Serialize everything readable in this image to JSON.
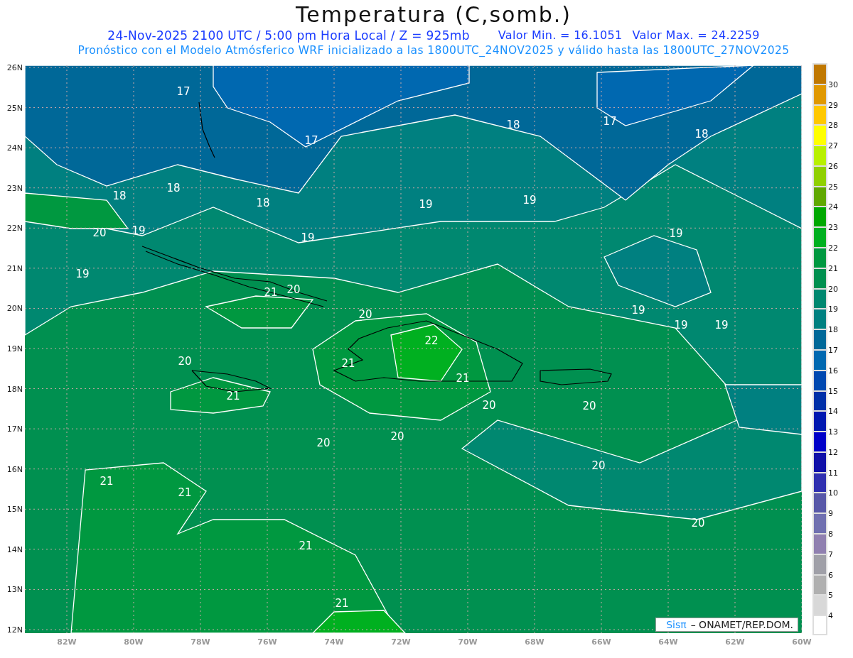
{
  "title": "Temperatura (C,somb.)",
  "subtitle": "24-Nov-2025  2100 UTC / 5:00 pm Hora Local / Z = 925mb",
  "value_min": "Valor Min. = 16.1051",
  "value_max": "Valor Max. = 24.2259",
  "forecast_note": "Pronóstico con el Modelo Atmósferico WRF inicializado a las 1800UTC_24NOV2025 y válido hasta las  1800UTC_27NOV2025",
  "map": {
    "lat_labels": [
      "26N",
      "25N",
      "24N",
      "23N",
      "22N",
      "21N",
      "20N",
      "19N",
      "18N",
      "17N",
      "16N",
      "15N",
      "14N",
      "13N",
      "12N"
    ],
    "lon_labels": [
      "82W",
      "80W",
      "78W",
      "76W",
      "74W",
      "72W",
      "70W",
      "68W",
      "66W",
      "64W",
      "62W",
      "60W"
    ],
    "contour_labels": [
      "17",
      "18",
      "17",
      "17",
      "18",
      "18",
      "18",
      "18",
      "19",
      "19",
      "20",
      "19",
      "19",
      "19",
      "19",
      "21",
      "20",
      "20",
      "19",
      "19",
      "19",
      "22",
      "20",
      "21",
      "21",
      "21",
      "20",
      "20",
      "20",
      "20",
      "21",
      "20",
      "21",
      "20",
      "21",
      "21"
    ]
  },
  "colorbar": {
    "bins": [
      {
        "color": "#c07800"
      },
      {
        "color": "#e09800"
      },
      {
        "color": "#ffc800"
      },
      {
        "color": "#ffff00"
      },
      {
        "color": "#b8f000"
      },
      {
        "color": "#90d000"
      },
      {
        "color": "#60a800"
      },
      {
        "color": "#00a800"
      },
      {
        "color": "#00b020"
      },
      {
        "color": "#009840"
      },
      {
        "color": "#009050"
      },
      {
        "color": "#008870"
      },
      {
        "color": "#008080"
      },
      {
        "color": "#006898"
      },
      {
        "color": "#0068b0"
      },
      {
        "color": "#0048b0"
      },
      {
        "color": "#0030a8"
      },
      {
        "color": "#0018b0"
      },
      {
        "color": "#0000c8"
      },
      {
        "color": "#1010a8"
      },
      {
        "color": "#3030b0"
      },
      {
        "color": "#5858a8"
      },
      {
        "color": "#7070b0"
      },
      {
        "color": "#9080b0"
      },
      {
        "color": "#a0a0a8"
      },
      {
        "color": "#b0b0b0"
      },
      {
        "color": "#d8d8d8"
      },
      {
        "color": "#ffffff"
      }
    ],
    "labels": [
      "30",
      "29",
      "28",
      "27",
      "26",
      "25",
      "24",
      "23",
      "22",
      "21",
      "20",
      "19",
      "18",
      "17",
      "16",
      "15",
      "14",
      "13",
      "12",
      "11",
      "10",
      "9",
      "8",
      "7",
      "6",
      "5",
      "4"
    ]
  },
  "credit": {
    "brand": "Sisπ",
    "org": "–  ONAMET/REP.DOM."
  }
}
